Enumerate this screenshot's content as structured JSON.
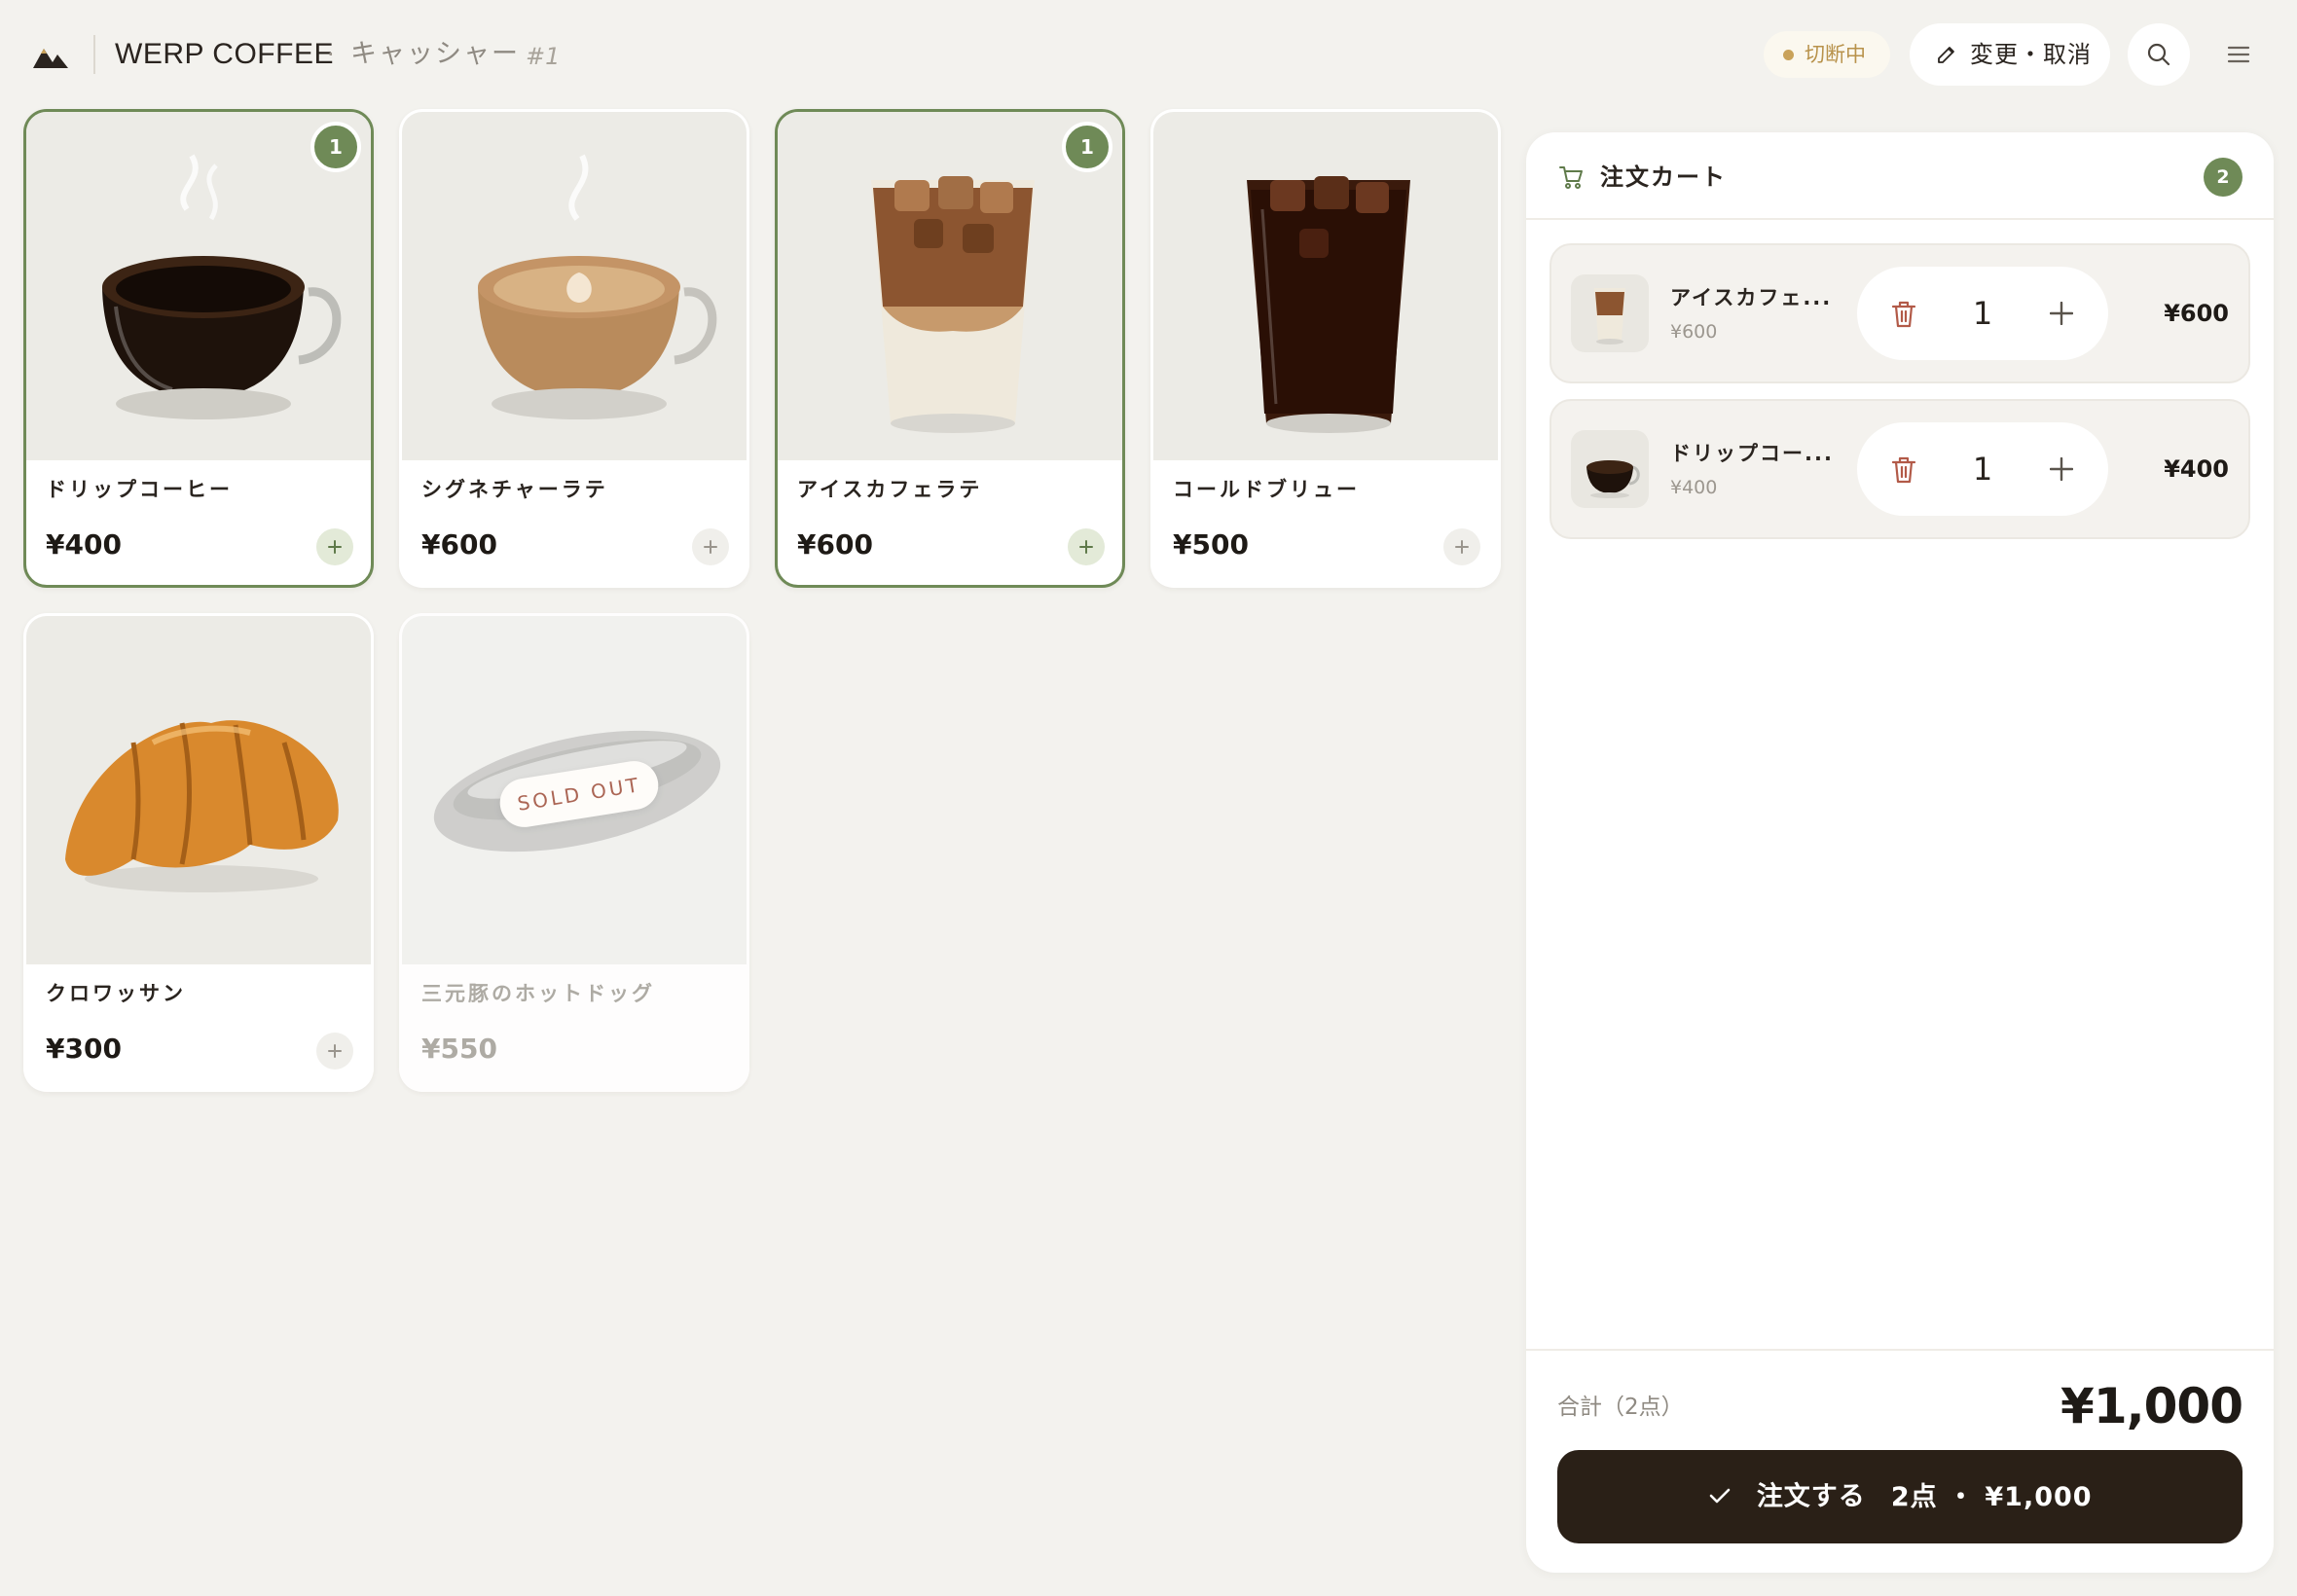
{
  "header": {
    "brand": "WERP COFFEE",
    "separator": "·",
    "subtitle": "キャッシャー",
    "terminal": "#1",
    "status": "切断中",
    "edit_button": "変更・取消",
    "icons": [
      "logo-mountain",
      "pencil-icon",
      "search-icon",
      "menu-icon"
    ]
  },
  "products": [
    {
      "name": "ドリップコーヒー",
      "price": "¥400",
      "badge": "1",
      "selected": true
    },
    {
      "name": "シグネチャーラテ",
      "price": "¥600"
    },
    {
      "name": "アイスカフェラテ",
      "price": "¥600",
      "badge": "1",
      "selected": true
    },
    {
      "name": "コールドブリュー",
      "price": "¥500"
    },
    {
      "name": "クロワッサン",
      "price": "¥300"
    },
    {
      "name": "三元豚のホットドッグ",
      "price": "¥550",
      "sold_out_label": "SOLD OUT",
      "sold_out": true
    }
  ],
  "cart": {
    "title": "注文カート",
    "count": "2",
    "items": [
      {
        "name": "アイスカフェ...",
        "unit_price": "¥600",
        "qty": "1",
        "total": "¥600"
      },
      {
        "name": "ドリップコー...",
        "unit_price": "¥400",
        "qty": "1",
        "total": "¥400"
      }
    ],
    "total_label": "合計（2点）",
    "total_value": "¥1,000",
    "order_label": "注文する",
    "order_summary": "2点 ・ ¥1,000"
  },
  "colors": {
    "background": "#f3f2ee",
    "accent_green": "#6f8a57",
    "order_button": "#2a2017",
    "status": "#c9a25a",
    "trash": "#b25a48"
  }
}
